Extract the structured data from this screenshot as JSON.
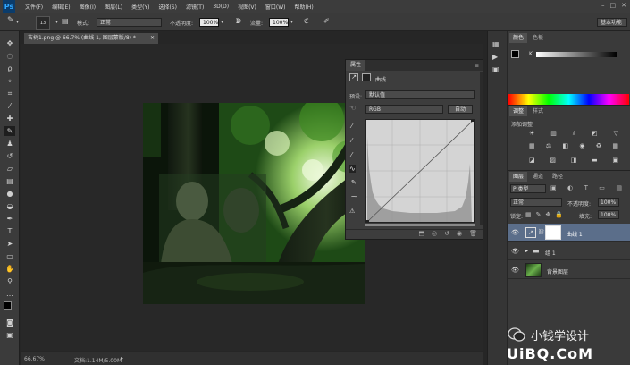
{
  "app": {
    "logo": "Ps"
  },
  "menu": [
    "文件(F)",
    "编辑(E)",
    "图像(I)",
    "图层(L)",
    "类型(Y)",
    "选择(S)",
    "滤镜(T)",
    "3D(D)",
    "视图(V)",
    "窗口(W)",
    "帮助(H)"
  ],
  "options": {
    "brush_size": "13",
    "mode_label": "模式:",
    "mode_value": "正常",
    "opacity_label": "不透明度:",
    "opacity_value": "100%",
    "flow_label": "流量:",
    "flow_value": "100%",
    "workspace": "基本功能"
  },
  "document": {
    "tab_title": "古树1.png @ 66.7% (曲线 1, 图层蒙版/8) *",
    "zoom": "66.67%",
    "doc_info": "文档:1.14M/5.00M"
  },
  "properties": {
    "title": "属性",
    "subtitle": "曲线",
    "preset_label": "预设:",
    "preset_value": "默认值",
    "channel_value": "RGB",
    "auto_label": "自动"
  },
  "color_panel": {
    "tabs": [
      "颜色",
      "色板"
    ],
    "k_label": "K"
  },
  "adjust_panel": {
    "tabs": [
      "调整",
      "样式"
    ],
    "add_label": "添加调整"
  },
  "layers_panel": {
    "tabs": [
      "图层",
      "通道",
      "路径"
    ],
    "kind_label": "P 类型",
    "blend_mode": "正常",
    "opacity_label": "不透明度:",
    "opacity_value": "100%",
    "lock_label": "锁定:",
    "fill_label": "填充:",
    "fill_value": "100%",
    "layers": [
      {
        "name": "曲线 1"
      },
      {
        "name": "组 1"
      },
      {
        "name": "背景图层"
      }
    ]
  },
  "watermark": {
    "text": "小钱学设计",
    "brand": "UiBQ.CoM"
  },
  "colors": {
    "accent": "#31a8ff",
    "selected_layer": "#5b6e8a"
  }
}
